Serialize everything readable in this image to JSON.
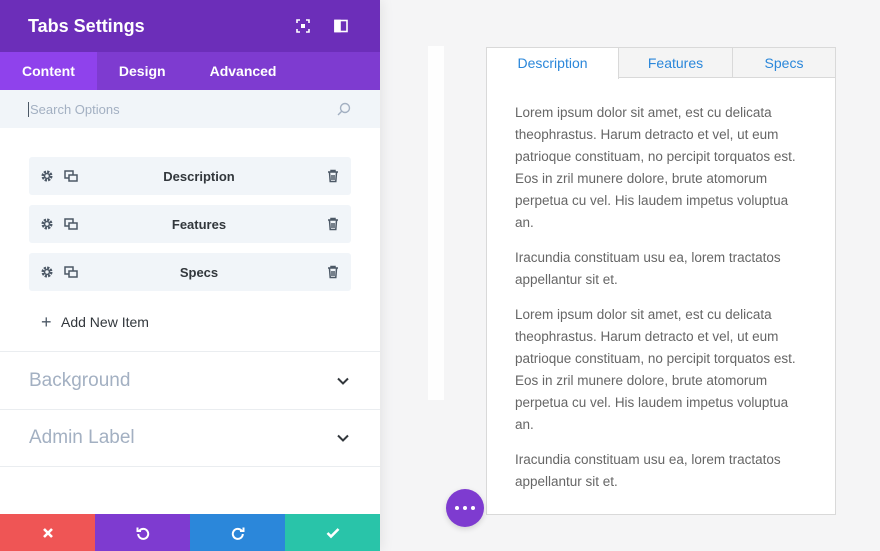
{
  "panel": {
    "title": "Tabs Settings",
    "header_icons": [
      "expand-icon",
      "sidebar-toggle-icon"
    ],
    "tabs": [
      {
        "label": "Content",
        "active": true
      },
      {
        "label": "Design",
        "active": false
      },
      {
        "label": "Advanced",
        "active": false
      }
    ],
    "search": {
      "placeholder": "Search Options",
      "value": ""
    },
    "items": [
      {
        "label": "Description"
      },
      {
        "label": "Features"
      },
      {
        "label": "Specs"
      }
    ],
    "add_item_label": "Add New Item",
    "sections": [
      {
        "title": "Background"
      },
      {
        "title": "Admin Label"
      }
    ],
    "footer_buttons": [
      "discard-icon",
      "undo-icon",
      "redo-icon",
      "save-icon"
    ]
  },
  "preview": {
    "tabs": [
      {
        "label": "Description",
        "active": true
      },
      {
        "label": "Features",
        "active": false
      },
      {
        "label": "Specs",
        "active": false
      }
    ],
    "paragraphs": [
      "Lorem ipsum dolor sit amet, est cu delicata theophrastus. Harum detracto et vel, ut eum patrioque constituam, no percipit torquatos est. Eos in zril munere dolore, brute atomorum perpetua cu vel. His laudem impetus voluptua an.",
      "Iracundia constituam usu ea, lorem tractatos appellantur sit et.",
      "Lorem ipsum dolor sit amet, est cu delicata theophrastus. Harum detracto et vel, ut eum patrioque constituam, no percipit torquatos est. Eos in zril munere dolore, brute atomorum perpetua cu vel. His laudem impetus voluptua an.",
      "Iracundia constituam usu ea, lorem tractatos appellantur sit et."
    ]
  },
  "colors": {
    "header": "#6c2eb9",
    "tabs_bar": "#7e3bd0",
    "active_tab": "#8f42ec",
    "discard": "#ef5555",
    "undo": "#7e3bd0",
    "redo": "#2b87da",
    "save": "#29c4a9",
    "link": "#2b87da"
  }
}
